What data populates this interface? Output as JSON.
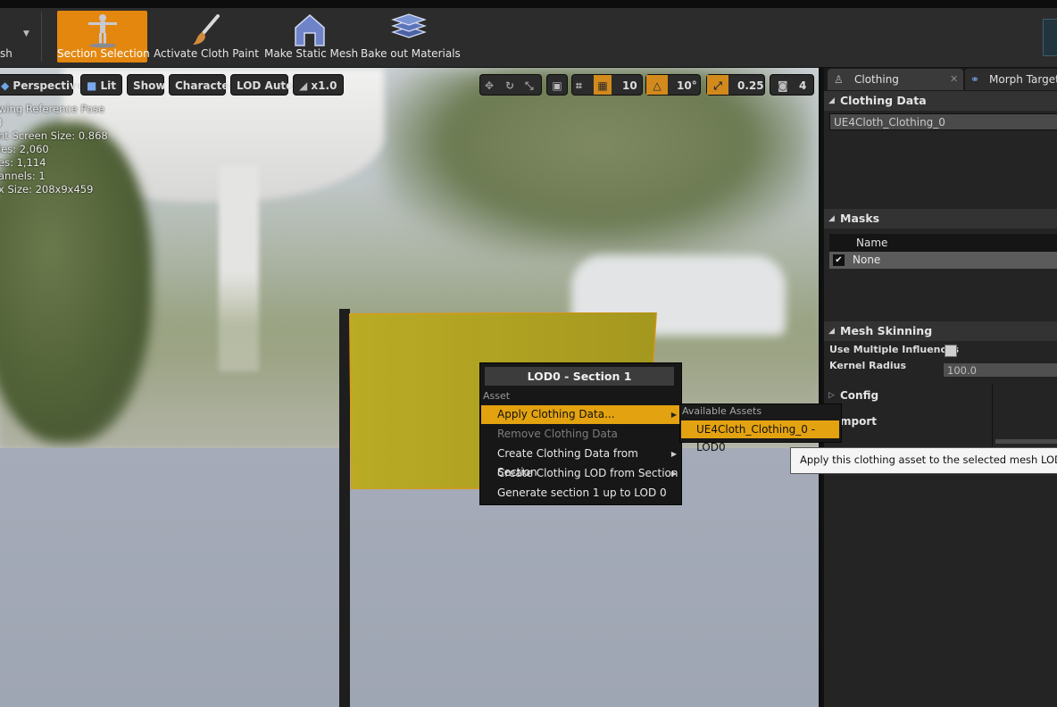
{
  "toolbar": {
    "left_partial_label": "sh",
    "buttons": [
      {
        "label": "Section Selection",
        "icon": "skeleton-figure-icon",
        "active": true
      },
      {
        "label": "Activate Cloth Paint",
        "icon": "paint-brush-icon",
        "active": false
      },
      {
        "label": "Make Static Mesh",
        "icon": "static-mesh-icon",
        "active": false
      },
      {
        "label": "Bake out Materials",
        "icon": "stacked-layers-icon",
        "active": false
      }
    ],
    "accent": "#e3870f"
  },
  "viewport": {
    "buttons": {
      "perspective": "Perspective",
      "lit": "Lit",
      "show": "Show",
      "character": "Character",
      "lod": "LOD Auto",
      "speed": "x1.0"
    },
    "right_controls": {
      "grid_snap": "10",
      "rotation_snap": "10°",
      "scale_snap": "0.25",
      "camera_speed": "4"
    },
    "info_lines": [
      "wing Reference Pose",
      ")",
      "nt Screen Size: 0.868",
      "les: 2,060",
      "es: 1,114",
      "annels: 1",
      "x Size: 208x9x459"
    ],
    "flag_color": "#b5a623"
  },
  "context_menu": {
    "title": "LOD0 - Section 1",
    "section_label": "Asset",
    "items": [
      {
        "label": "Apply Clothing Data...",
        "highlighted": true,
        "submenu": true,
        "enabled": true
      },
      {
        "label": "Remove Clothing Data",
        "highlighted": false,
        "submenu": false,
        "enabled": false
      },
      {
        "label": "Create Clothing Data from Section",
        "highlighted": false,
        "submenu": true,
        "enabled": true
      },
      {
        "label": "Create Clothing LOD from Section",
        "highlighted": false,
        "submenu": true,
        "enabled": true
      },
      {
        "label": "Generate section 1 up to LOD 0",
        "highlighted": false,
        "submenu": false,
        "enabled": true
      }
    ],
    "submenu": {
      "header": "Available Assets",
      "item": "UE4Cloth_Clothing_0 - LOD0"
    },
    "tooltip": "Apply this clothing asset to the selected mesh LOD and se"
  },
  "right_panel": {
    "tabs": [
      "Clothing",
      "Morph Target P"
    ],
    "clothing_data": {
      "header": "Clothing Data",
      "value": "UE4Cloth_Clothing_0"
    },
    "masks": {
      "header": "Masks",
      "column": "Name",
      "row": "None"
    },
    "mesh_skinning": {
      "header": "Mesh Skinning",
      "use_multiple_influences": "Use Multiple Influences",
      "kernel_radius_label": "Kernel Radius",
      "kernel_radius_value": "100.0"
    },
    "config_header": "Config",
    "import_header": "mport"
  }
}
